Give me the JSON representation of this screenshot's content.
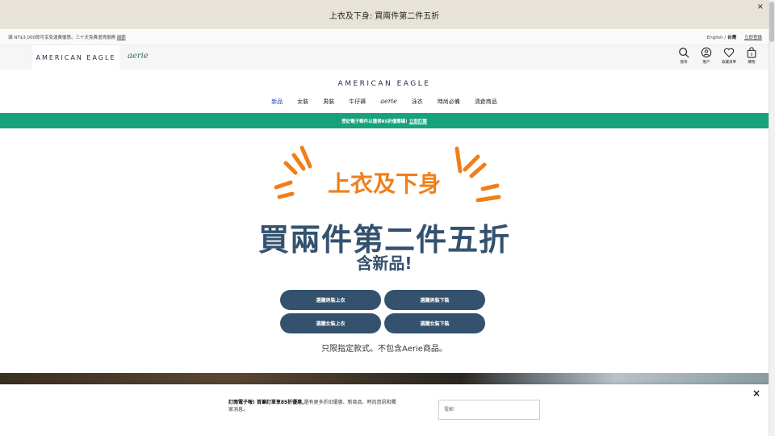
{
  "promo_bar": {
    "text": "上衣及下身: 買兩件第二件五折",
    "close": "×"
  },
  "utility": {
    "shipping_text": "滿 NT$3,000即可享免運費優惠。三十天免費退貨服務 ",
    "shipping_link": "細節",
    "lang_english": "English /",
    "lang_region": "台灣",
    "sign_in": "立即登錄"
  },
  "brand": {
    "ae": "AMERICAN EAGLE",
    "aerie": "aerie"
  },
  "header_icons": [
    {
      "label": "搜尋",
      "icon": "search-icon"
    },
    {
      "label": "帳戶",
      "icon": "account-icon"
    },
    {
      "label": "收藏清單",
      "icon": "heart-icon"
    },
    {
      "label": "購物",
      "icon": "bag-icon",
      "count": "0"
    }
  ],
  "logo_main": "AMERICAN EAGLE",
  "nav": [
    "新品",
    "女裝",
    "男裝",
    "牛仔褲",
    "aerie",
    "泳衣",
    "時尚必備",
    "清倉商品"
  ],
  "green_bar": {
    "text": "登記電子郵件以獲得85折優惠碼!",
    "link": "立即訂閱"
  },
  "hero": {
    "top": "上衣及下身",
    "main": "買兩件第二件五折",
    "sub": "含新品!",
    "buttons": [
      "選購男裝上衣",
      "選購男裝下裝",
      "選購女裝上衣",
      "選購女裝下裝"
    ],
    "note": "只限指定款式。不包含Aerie商品。"
  },
  "newsletter": {
    "bold": "訂閱電子報! 首筆訂單享85折優惠,",
    "rest": "還有更多折扣優惠、新商品、時尚資訊和獨家消息。",
    "placeholder": "電郵",
    "close": "×"
  },
  "colors": {
    "accent_orange": "#f07f1a",
    "navy": "#34526e",
    "green": "#18a27b",
    "promo_bg": "#e8e3d8"
  }
}
